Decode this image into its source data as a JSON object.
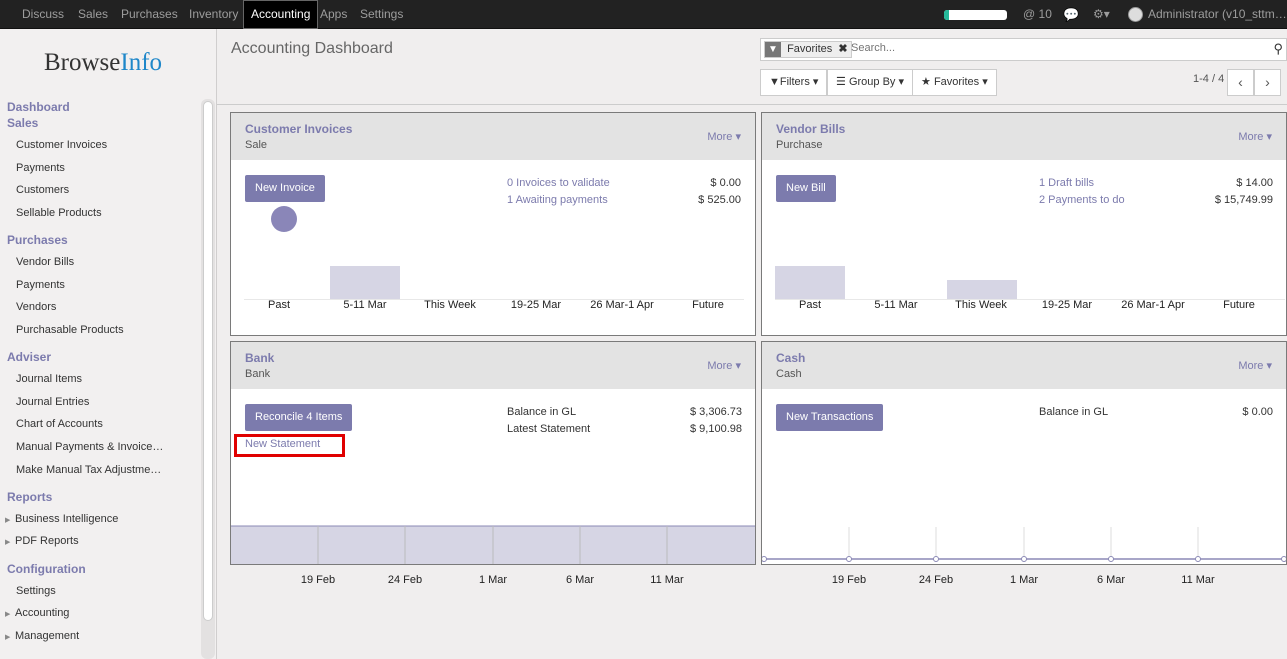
{
  "topbar": {
    "menus": [
      "Discuss",
      "Sales",
      "Purchases",
      "Inventory",
      "Accounting",
      "Apps",
      "Settings"
    ],
    "active_menu": "Accounting",
    "mentions": "@ 10",
    "user": "Administrator (v10_sttm…"
  },
  "sidebar": {
    "logo_browse": "Browse",
    "logo_info": "Info",
    "sections": [
      {
        "title": "Dashboard",
        "items": []
      },
      {
        "title": "Sales",
        "items": [
          "Customer Invoices",
          "Payments",
          "Customers",
          "Sellable Products"
        ]
      },
      {
        "title": "Purchases",
        "items": [
          "Vendor Bills",
          "Payments",
          "Vendors",
          "Purchasable Products"
        ]
      },
      {
        "title": "Adviser",
        "items": [
          "Journal Items",
          "Journal Entries",
          "Chart of Accounts",
          "Manual Payments & Invoice…",
          "Make Manual Tax Adjustme…"
        ]
      },
      {
        "title": "Reports",
        "items": [
          "Business Intelligence",
          "PDF Reports"
        ]
      },
      {
        "title": "Configuration",
        "items": [
          "Settings",
          "Accounting",
          "Management"
        ]
      }
    ]
  },
  "header": {
    "breadcrumb": "Accounting Dashboard",
    "search_facet": "Favorites",
    "search_placeholder": "Search...",
    "filters_label": "Filters",
    "groupby_label": "Group By",
    "favorites_label": "Favorites",
    "pager": "1-4 / 4"
  },
  "cards": {
    "customer_invoices": {
      "title": "Customer Invoices",
      "subtitle": "Sale",
      "more": "More",
      "button": "New Invoice",
      "link1": "0 Invoices to validate",
      "amount1": "$ 0.00",
      "link2": "1 Awaiting payments",
      "amount2": "$ 525.00",
      "xlabels": [
        "Past",
        "5-11 Mar",
        "This Week",
        "19-25 Mar",
        "26 Mar-1 Apr",
        "Future"
      ]
    },
    "vendor_bills": {
      "title": "Vendor Bills",
      "subtitle": "Purchase",
      "more": "More",
      "button": "New Bill",
      "link1": "1 Draft bills",
      "amount1": "$ 14.00",
      "link2": "2 Payments to do",
      "amount2": "$ 15,749.99",
      "xlabels": [
        "Past",
        "5-11 Mar",
        "This Week",
        "19-25 Mar",
        "26 Mar-1 Apr",
        "Future"
      ]
    },
    "bank": {
      "title": "Bank",
      "subtitle": "Bank",
      "more": "More",
      "button": "Reconcile 4 Items",
      "link": "New Statement",
      "label1": "Balance in GL",
      "amount1": "$ 3,306.73",
      "label2": "Latest Statement",
      "amount2": "$ 9,100.98",
      "xlabels": [
        "19 Feb",
        "24 Feb",
        "1 Mar",
        "6 Mar",
        "11 Mar"
      ]
    },
    "cash": {
      "title": "Cash",
      "subtitle": "Cash",
      "more": "More",
      "button": "New Transactions",
      "label1": "Balance in GL",
      "amount1": "$ 0.00",
      "xlabels": [
        "19 Feb",
        "24 Feb",
        "1 Mar",
        "6 Mar",
        "11 Mar"
      ]
    }
  },
  "colors": {
    "accent": "#7c7bad",
    "highlight": "#e00000",
    "topbar": "#222222"
  }
}
